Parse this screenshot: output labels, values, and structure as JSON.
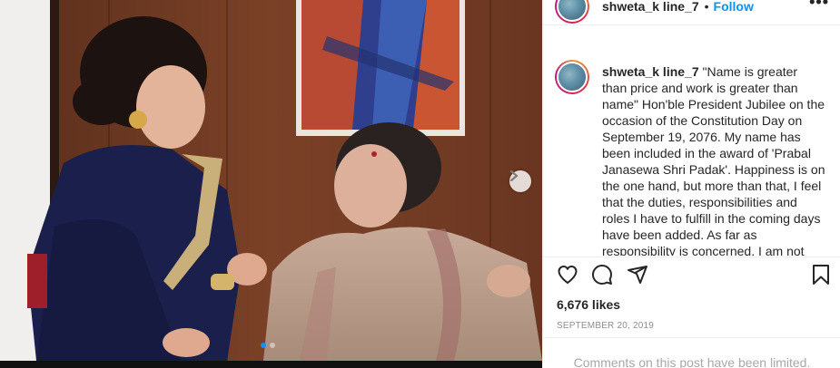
{
  "post": {
    "username": "shweta_k line_7",
    "follow_label": "Follow",
    "separator": "•",
    "more_label": "•••",
    "caption_text": "\"Name is greater than price and work is greater than name\" Hon'ble President Jubilee on the occasion of the Constitution Day on September 19, 2076. My name has been included in the award of 'Prabal Janasewa Shri Padak'. Happiness is on the one hand, but more than that, I feel that the duties, responsibilities and roles I have to fulfill in the coming days have been added. As far as responsibility is concerned, I am not",
    "likes": "6,676 likes",
    "date": "SEPTEMBER 20, 2019",
    "comments_notice": "Comments on this post have been limited."
  },
  "carousel": {
    "slide_count": 2,
    "active_slide": 1
  },
  "icons": {
    "like": "heart-icon",
    "comment": "comment-icon",
    "share": "share-icon",
    "save": "bookmark-icon",
    "next": "chevron-right-icon",
    "more": "more-icon"
  },
  "colors": {
    "follow": "#0095f6",
    "muted": "#8e8e8e",
    "active_dot": "#0095f6"
  }
}
